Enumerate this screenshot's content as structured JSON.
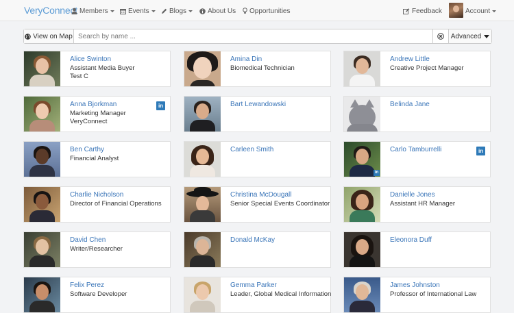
{
  "nav": {
    "brand": "VeryConnect",
    "members": "Members",
    "events": "Events",
    "blogs": "Blogs",
    "about": "About Us",
    "opportunities": "Opportunities",
    "feedback": "Feedback",
    "account": "Account"
  },
  "search": {
    "view_map": "View on Map",
    "placeholder": "Search by name ...",
    "value": "",
    "advanced": "Advanced"
  },
  "colors": {
    "accent": "#3a75b8",
    "linkedin": "#2e7ab8",
    "brand": "#5b9bd5"
  },
  "members": [
    {
      "name": "Alice Swinton",
      "line1": "Assistant Media Buyer",
      "line2": "Test C",
      "linkedin": false
    },
    {
      "name": "Amina Din",
      "line1": "Biomedical Technician",
      "line2": "",
      "linkedin": false
    },
    {
      "name": "Andrew Little",
      "line1": "Creative Project Manager",
      "line2": "",
      "linkedin": false
    },
    {
      "name": "Anna Bjorkman",
      "line1": "Marketing Manager",
      "line2": "VeryConnect",
      "linkedin": true
    },
    {
      "name": "Bart Lewandowski",
      "line1": "",
      "line2": "",
      "linkedin": false
    },
    {
      "name": "Belinda Jane",
      "line1": "",
      "line2": "",
      "linkedin": false
    },
    {
      "name": "Ben Carthy",
      "line1": "Financial Analyst",
      "line2": "",
      "linkedin": false
    },
    {
      "name": "Carleen Smith",
      "line1": "",
      "line2": "",
      "linkedin": false
    },
    {
      "name": "Carlo Tamburrelli",
      "line1": "",
      "line2": "",
      "linkedin": true
    },
    {
      "name": "Charlie Nicholson",
      "line1": "Director of Financial Operations",
      "line2": "",
      "linkedin": false
    },
    {
      "name": "Christina McDougall",
      "line1": "Senior Special Events Coordinator",
      "line2": "",
      "linkedin": false
    },
    {
      "name": "Danielle Jones",
      "line1": "Assistant HR Manager",
      "line2": "",
      "linkedin": false
    },
    {
      "name": "David Chen",
      "line1": "Writer/Researcher",
      "line2": "",
      "linkedin": false
    },
    {
      "name": "Donald McKay",
      "line1": "",
      "line2": "",
      "linkedin": false
    },
    {
      "name": "Eleonora Duff",
      "line1": "",
      "line2": "",
      "linkedin": false
    },
    {
      "name": "Felix Perez",
      "line1": "Software Developer",
      "line2": "",
      "linkedin": false
    },
    {
      "name": "Gemma Parker",
      "line1": "Leader, Global Medical Information",
      "line2": "",
      "linkedin": false
    },
    {
      "name": "James Johnston",
      "line1": "Professor of International Law",
      "line2": "",
      "linkedin": false
    }
  ]
}
